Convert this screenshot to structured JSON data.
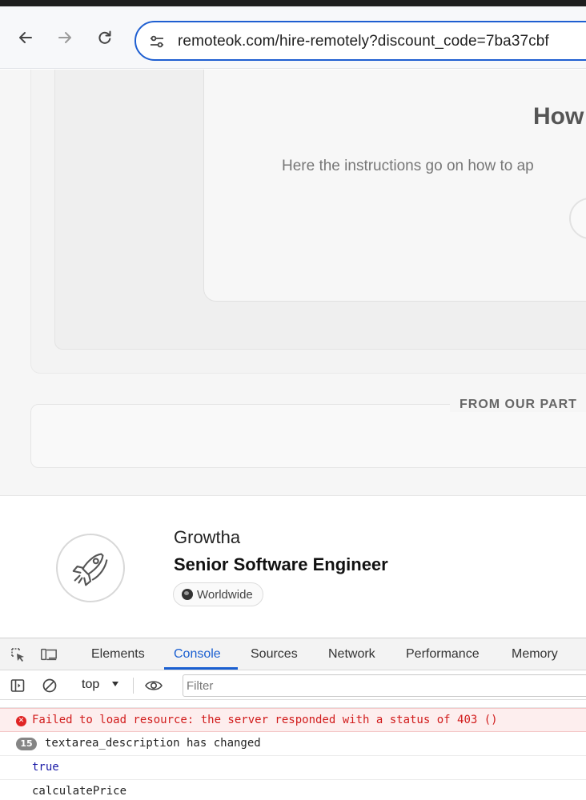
{
  "browser": {
    "url": "remoteok.com/hire-remotely?discount_code=7ba37cbf"
  },
  "page": {
    "how_title": "How",
    "how_text": "Here the instructions go on how to ap",
    "partner_label": "FROM OUR PART",
    "job": {
      "company": "Growtha",
      "title": "Senior Software Engineer",
      "location": "Worldwide"
    }
  },
  "devtools": {
    "tabs": [
      {
        "label": "Elements",
        "active": false
      },
      {
        "label": "Console",
        "active": true
      },
      {
        "label": "Sources",
        "active": false
      },
      {
        "label": "Network",
        "active": false
      },
      {
        "label": "Performance",
        "active": false
      },
      {
        "label": "Memory",
        "active": false
      }
    ],
    "context": "top",
    "filter_placeholder": "Filter",
    "messages": {
      "error": "Failed to load resource: the server responded with a status of 403 ()",
      "log_count": "15",
      "log": "textarea_description has changed",
      "value_true": "true",
      "value_calc": "calculatePrice"
    }
  },
  "colors": {
    "accent": "#1a5fd1",
    "error": "#d11b1b",
    "error_bg": "#fdeeee"
  },
  "icons": [
    "back-arrow-icon",
    "forward-arrow-icon",
    "reload-icon",
    "site-settings-icon",
    "rocket-logo-icon",
    "globe-icon",
    "inspect-element-icon",
    "device-toolbar-icon",
    "sidebar-toggle-icon",
    "clear-console-icon",
    "eye-icon",
    "error-icon"
  ]
}
